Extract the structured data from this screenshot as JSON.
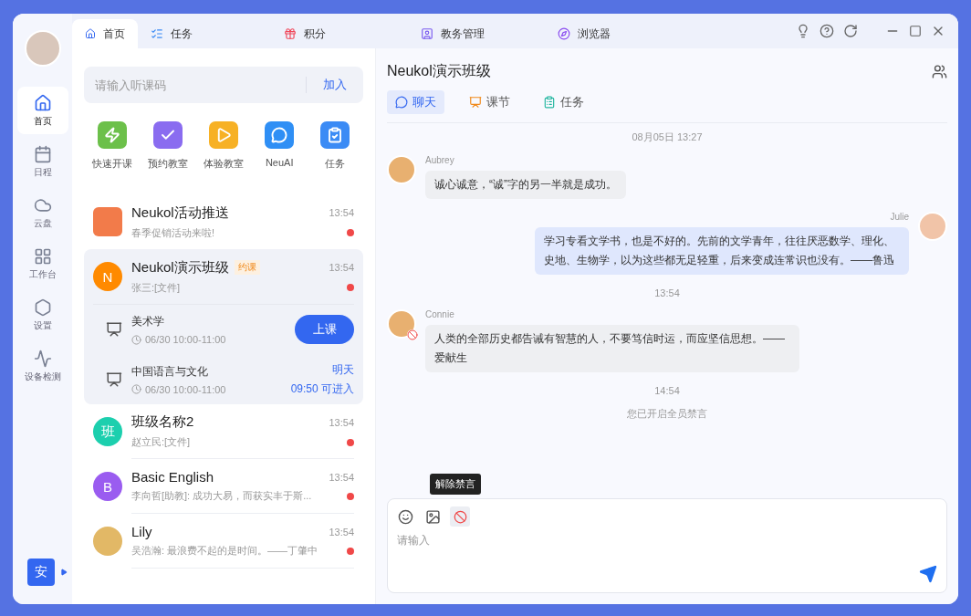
{
  "sidebar": {
    "items": [
      {
        "kind": "home",
        "label": "首页",
        "selected": true
      },
      {
        "kind": "calendar",
        "label": "日程",
        "selected": false
      },
      {
        "kind": "cloud",
        "label": "云盘",
        "selected": false
      },
      {
        "kind": "apps",
        "label": "工作台",
        "selected": false
      },
      {
        "kind": "settings",
        "label": "设置",
        "selected": false
      },
      {
        "kind": "monitor",
        "label": "设备检测",
        "selected": false
      }
    ],
    "account_badge": "安"
  },
  "tabs": [
    {
      "kind": "home",
      "label": "首页",
      "selected": true
    },
    {
      "kind": "task",
      "label": "任务",
      "selected": false
    },
    {
      "kind": "points",
      "label": "积分",
      "selected": false
    },
    {
      "kind": "admin",
      "label": "教务管理",
      "selected": false
    },
    {
      "kind": "browser",
      "label": "浏览器",
      "selected": false
    }
  ],
  "join": {
    "placeholder": "请输入听课码",
    "button": "加入"
  },
  "shortcuts": [
    {
      "kind": "quick",
      "label": "快速开课"
    },
    {
      "kind": "book",
      "label": "预约教室"
    },
    {
      "kind": "trial",
      "label": "体验教室"
    },
    {
      "kind": "ai",
      "label": "NeuAI"
    },
    {
      "kind": "task",
      "label": "任务"
    }
  ],
  "conversations": [
    {
      "kind": "photo",
      "title": "Neukol活动推送",
      "time": "13:54",
      "preview": "春季促销活动来啦!",
      "unread": true,
      "selected": false
    },
    {
      "kind": "letter",
      "letter": "N",
      "color": "#ff8a00",
      "title": "Neukol演示班级",
      "tag": "约课",
      "time": "13:54",
      "preview": "张三:[文件]",
      "unread": true,
      "selected": true,
      "lessons": [
        {
          "title": "美术学",
          "time": "06/30 10:00-11:00",
          "action": {
            "kind": "button",
            "label": "上课"
          }
        },
        {
          "title": "中国语言与文化",
          "time": "06/30 10:00-11:00",
          "action": {
            "kind": "text",
            "lines": [
              "明天",
              "09:50 可进入"
            ]
          }
        }
      ]
    },
    {
      "kind": "letter",
      "letter": "班",
      "color": "#1ccfae",
      "title": "班级名称2",
      "time": "13:54",
      "preview": "赵立民:[文件]",
      "unread": true,
      "selected": false
    },
    {
      "kind": "letter",
      "letter": "B",
      "color": "#9a5cf0",
      "title": "Basic English",
      "time": "13:54",
      "preview": "李向哲[助教]: 成功大易，而获实丰于斯...",
      "unread": true,
      "selected": false
    },
    {
      "kind": "photo",
      "title": "Lily",
      "time": "13:54",
      "preview": "吴浩瀚: 最浪费不起的是时间。——丁肇中",
      "unread": true,
      "selected": false
    }
  ],
  "chat": {
    "title": "Neukol演示班级",
    "tabs": [
      {
        "kind": "chat",
        "label": "聊天",
        "selected": true
      },
      {
        "kind": "lesson",
        "label": "课节",
        "selected": false
      },
      {
        "kind": "task",
        "label": "任务",
        "selected": false
      }
    ],
    "messages": [
      {
        "kind": "time",
        "text": "08月05日 13:27"
      },
      {
        "kind": "message",
        "outgoing": false,
        "name": "Aubrey",
        "muted": false,
        "text": "诚心诚意，“诚”字的另一半就是成功。"
      },
      {
        "kind": "message",
        "outgoing": true,
        "name": "Julie",
        "muted": false,
        "text": "学习专看文学书，也是不好的。先前的文学青年，往往厌恶数学、理化、史地、生物学，以为这些都无足轻重，后来变成连常识也没有。——鲁迅"
      },
      {
        "kind": "time",
        "text": "13:54"
      },
      {
        "kind": "message",
        "outgoing": false,
        "name": "Connie",
        "muted": true,
        "text": "人类的全部历史都告诫有智慧的人，不要笃信时运，而应坚信思想。—— 爱献生"
      },
      {
        "kind": "time",
        "text": "14:54"
      },
      {
        "kind": "notice",
        "text": "您已开启全员禁言"
      }
    ],
    "tooltip": "解除禁言",
    "input": {
      "placeholder": "请输入"
    }
  }
}
